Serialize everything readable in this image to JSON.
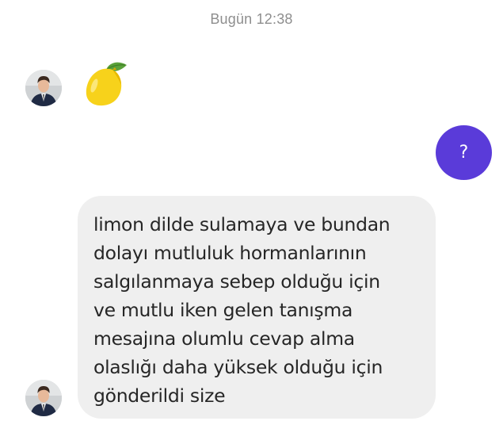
{
  "thread": {
    "timestamp": "Bugün 12:38"
  },
  "messages": [
    {
      "direction": "incoming",
      "content_type": "emoji",
      "emoji": "lemon-icon"
    },
    {
      "direction": "outgoing",
      "content_type": "text",
      "text": "?"
    },
    {
      "direction": "incoming",
      "content_type": "text",
      "lines": [
        "limon dilde sulamaya ve bundan",
        "dolayı mutluluk hormanlarının",
        "salgılanmaya sebep olduğu için",
        "ve mutlu iken gelen tanışma",
        "mesajına olumlu cevap alma",
        "olaslığı daha yüksek olduğu için",
        "gönderildi size"
      ]
    }
  ],
  "colors": {
    "outgoing_bubble": "#5a3bd9",
    "incoming_bubble": "#efefef",
    "timestamp_text": "#8e8e8e",
    "message_text": "#262626"
  }
}
